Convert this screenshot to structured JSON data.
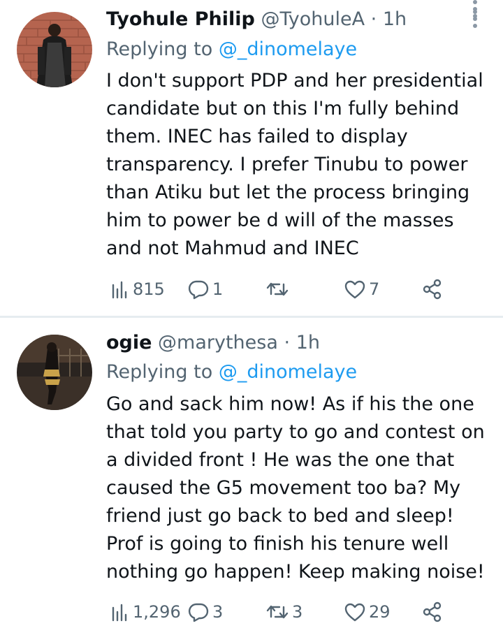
{
  "tweets": [
    {
      "name": "Tyohule Philip",
      "handle": "@TyohuleA",
      "separator": "·",
      "time": "1h",
      "replying_prefix": "Replying to",
      "replying_to": "@_dinomelaye",
      "body_lines": [
        "I don't support PDP and her presidential",
        "candidate but on this I'm fully behind",
        "them. INEC has failed to display",
        "transparency. I prefer Tinubu to power",
        "than Atiku but let the process bringing",
        "him to power be d will of the masses",
        "and not Mahmud and INEC"
      ],
      "views": "815",
      "replies": "1",
      "retweets": "",
      "likes": "7"
    },
    {
      "name": "ogie",
      "handle": "@marythesa",
      "separator": "·",
      "time": "1h",
      "replying_prefix": "Replying to",
      "replying_to": "@_dinomelaye",
      "body_lines": [
        "Go and sack him now! As if his the one",
        "that told you party to go and contest on",
        "a divided front ! He was the one that",
        "caused the G5 movement too ba? My",
        "friend just go back to bed and sleep!",
        "Prof is going to finish his tenure well",
        "nothing go happen! Keep making noise!"
      ],
      "views": "1,296",
      "replies": "3",
      "retweets": "3",
      "likes": "29"
    }
  ],
  "icons": {
    "views": "views-icon",
    "reply": "reply-icon",
    "retweet": "retweet-icon",
    "like": "like-icon",
    "share": "share-icon",
    "more": "more-icon"
  },
  "colors": {
    "text": "#0f1419",
    "secondary": "#536471",
    "link": "#1d9bf0",
    "divider": "#e6ecf0"
  }
}
